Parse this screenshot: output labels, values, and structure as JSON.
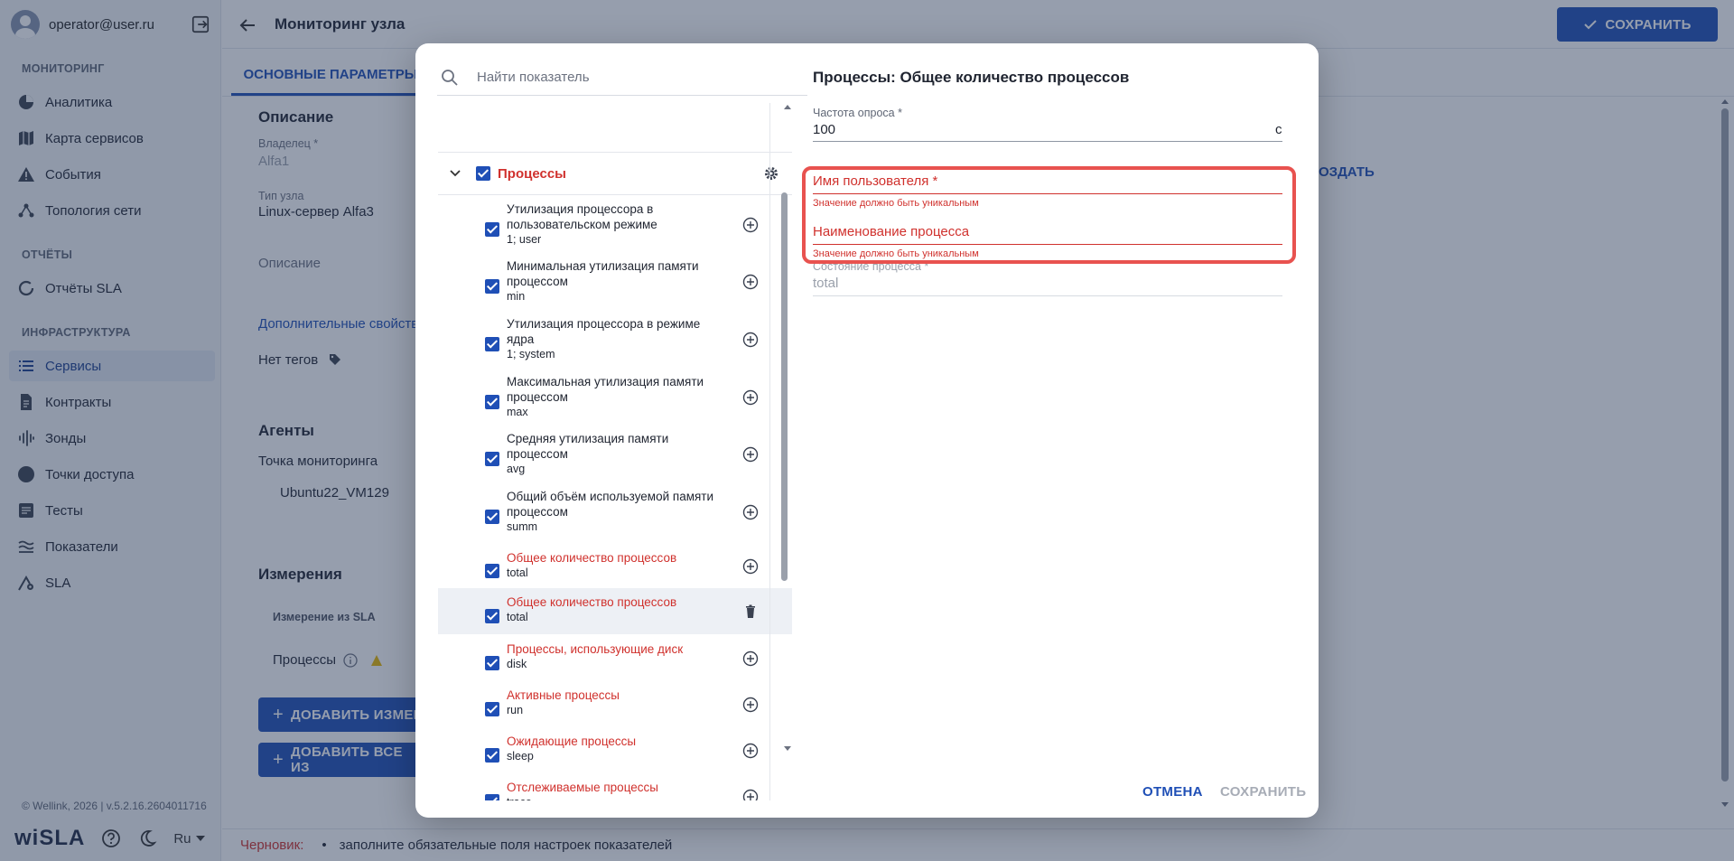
{
  "user": {
    "email": "operator@user.ru"
  },
  "sidebar": {
    "sections": [
      {
        "title": "МОНИТОРИНГ",
        "items": [
          "Аналитика",
          "Карта сервисов",
          "События",
          "Топология сети"
        ]
      },
      {
        "title": "ОТЧЁТЫ",
        "items": [
          "Отчёты SLA"
        ]
      },
      {
        "title": "ИНФРАСТРУКТУРА",
        "items": [
          "Сервисы",
          "Контракты",
          "Зонды",
          "Точки доступа",
          "Тесты",
          "Показатели",
          "SLA"
        ]
      }
    ],
    "active_item": "Сервисы",
    "footer": "© Wellink, 2026 | v.5.2.16.2604011716",
    "logo": "wiSLA",
    "language": "Ru"
  },
  "header": {
    "title": "Мониторинг узла",
    "save_label": "СОХРАНИТЬ"
  },
  "tabs": {
    "main": "ОСНОВНЫЕ ПАРАМЕТРЫ"
  },
  "content": {
    "description_title": "Описание",
    "owner_label": "Владелец *",
    "owner_value": "Alfa1",
    "node_type_label": "Тип узла",
    "node_type_value": "Linux-сервер Alfa3",
    "description_placeholder": "Описание",
    "extra_props_link": "Дополнительные свойства",
    "no_tags": "Нет тегов",
    "agents_title": "Агенты",
    "monitoring_point_label": "Точка мониторинга",
    "agent_item": "Ubuntu22_VM129",
    "measurements_title": "Измерения",
    "table_header": "Измерение из SLA",
    "table_row": "Процессы",
    "add_measurement_btn": "ДОБАВИТЬ ИЗМЕР",
    "add_all_btn": "ДОБАВИТЬ ВСЕ ИЗ",
    "create_link": "ОЗДАТЬ"
  },
  "status_bar": {
    "label": "Черновик:",
    "message": "заполните обязательные поля настроек показателей"
  },
  "dialog": {
    "search_placeholder": "Найти показатель",
    "group_label": "Процессы",
    "items": [
      {
        "name": "Утилизация процессора в пользовательском режиме",
        "sub": "1; user",
        "red": false,
        "action": "add"
      },
      {
        "name": "Минимальная утилизация памяти процессом",
        "sub": "min",
        "red": false,
        "action": "add"
      },
      {
        "name": "Утилизация процессора в режиме ядра",
        "sub": "1; system",
        "red": false,
        "action": "add"
      },
      {
        "name": "Максимальная утилизация памяти процессом",
        "sub": "max",
        "red": false,
        "action": "add"
      },
      {
        "name": "Средняя утилизация памяти процессом",
        "sub": "avg",
        "red": false,
        "action": "add"
      },
      {
        "name": "Общий объём используемой памяти процессом",
        "sub": "summ",
        "red": false,
        "action": "add"
      },
      {
        "name": "Общее количество процессов",
        "sub": "total",
        "red": true,
        "action": "add"
      },
      {
        "name": "Общее количество процессов",
        "sub": "total",
        "red": true,
        "action": "delete"
      },
      {
        "name": "Процессы, использующие диск",
        "sub": "disk",
        "red": true,
        "action": "add"
      },
      {
        "name": "Активные процессы",
        "sub": "run",
        "red": true,
        "action": "add"
      },
      {
        "name": "Ожидающие процессы",
        "sub": "sleep",
        "red": true,
        "action": "add"
      },
      {
        "name": "Отслеживаемые процессы",
        "sub": "trace",
        "red": true,
        "action": "add"
      }
    ],
    "detail_title": "Процессы: Общее количество процессов",
    "poll_label": "Частота опроса *",
    "poll_value": "100",
    "poll_unit": "с",
    "username_label": "Имя пользователя *",
    "username_error": "Значение должно быть уникальным",
    "process_name_label": "Наименование процесса",
    "process_name_error": "Значение должно быть уникальным",
    "state_label": "Состояние процесса *",
    "state_value": "total",
    "cancel_label": "ОТМЕНА",
    "save_label": "СОХРАНИТЬ"
  }
}
